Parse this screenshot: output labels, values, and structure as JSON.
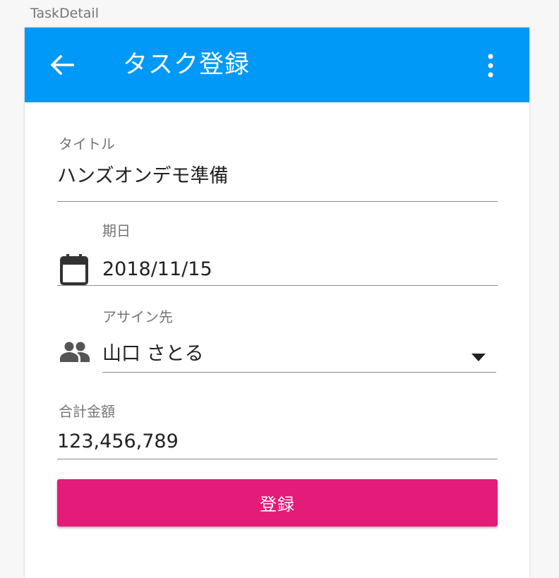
{
  "window": {
    "label": "TaskDetail"
  },
  "appbar": {
    "title": "タスク登録",
    "back_icon": "arrow-left-icon",
    "menu_icon": "more-vert-icon",
    "color": "#0199f8"
  },
  "form": {
    "title_field": {
      "label": "タイトル",
      "value": "ハンズオンデモ準備"
    },
    "due_field": {
      "label": "期日",
      "value": "2018/11/15",
      "icon": "calendar-icon"
    },
    "assignee_field": {
      "label": "アサイン先",
      "value": "山口 さとる",
      "icon": "people-icon",
      "dropdown_icon": "arrow-drop-down-icon"
    },
    "amount_field": {
      "label": "合計金額",
      "value": "123,456,789"
    },
    "submit_label": "登録",
    "submit_color": "#e41b78"
  }
}
